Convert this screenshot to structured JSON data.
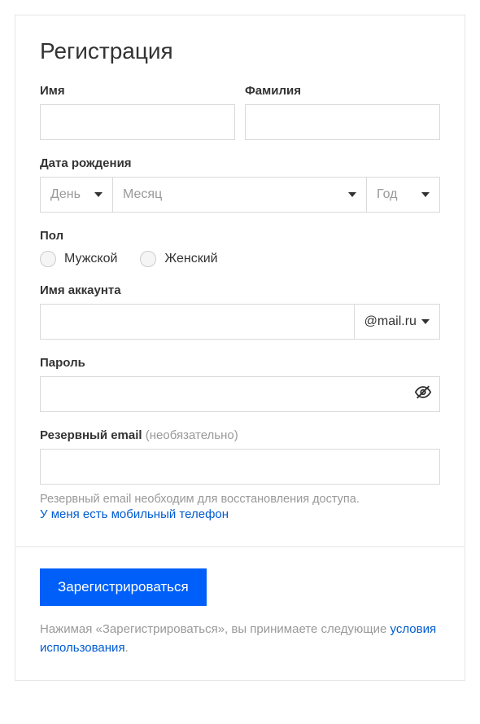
{
  "title": "Регистрация",
  "labels": {
    "firstname": "Имя",
    "lastname": "Фамилия",
    "dob": "Дата рождения",
    "gender": "Пол",
    "account": "Имя аккаунта",
    "password": "Пароль",
    "reserve_email": "Резервный email",
    "reserve_hint": "(необязательно)"
  },
  "dob": {
    "day": "День",
    "month": "Месяц",
    "year": "Год"
  },
  "gender": {
    "male": "Мужской",
    "female": "Женский"
  },
  "domain": "@mail.ru",
  "reserve_note": "Резервный email необходим для восстановления доступа.",
  "phone_link": "У меня есть мобильный телефон",
  "submit": "Зарегистрироваться",
  "terms_prefix": "Нажимая «Зарегистрироваться», вы принимаете следующие ",
  "terms_link": "условия использования",
  "terms_suffix": "."
}
